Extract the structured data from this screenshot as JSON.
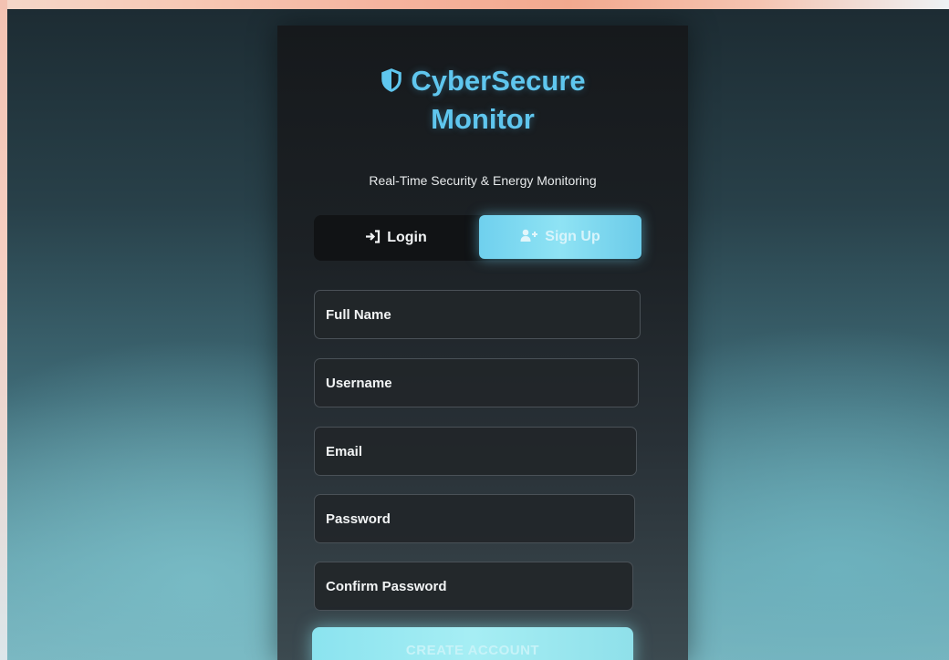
{
  "brand": {
    "line1": "CyberSecure",
    "line2": "Monitor",
    "subtitle": "Real-Time Security & Energy Monitoring",
    "accent": "#5fc6ee"
  },
  "tabs": {
    "login_label": "Login",
    "signup_label": "Sign Up",
    "active": "signup"
  },
  "form": {
    "fields": [
      {
        "label": "Full Name"
      },
      {
        "label": "Username"
      },
      {
        "label": "Email"
      },
      {
        "label": "Password"
      },
      {
        "label": "Confirm Password"
      }
    ],
    "submit_label": "CREATE ACCOUNT"
  },
  "icons": {
    "brand": "shield-icon",
    "login": "sign-in-icon",
    "signup": "user-plus-icon"
  }
}
